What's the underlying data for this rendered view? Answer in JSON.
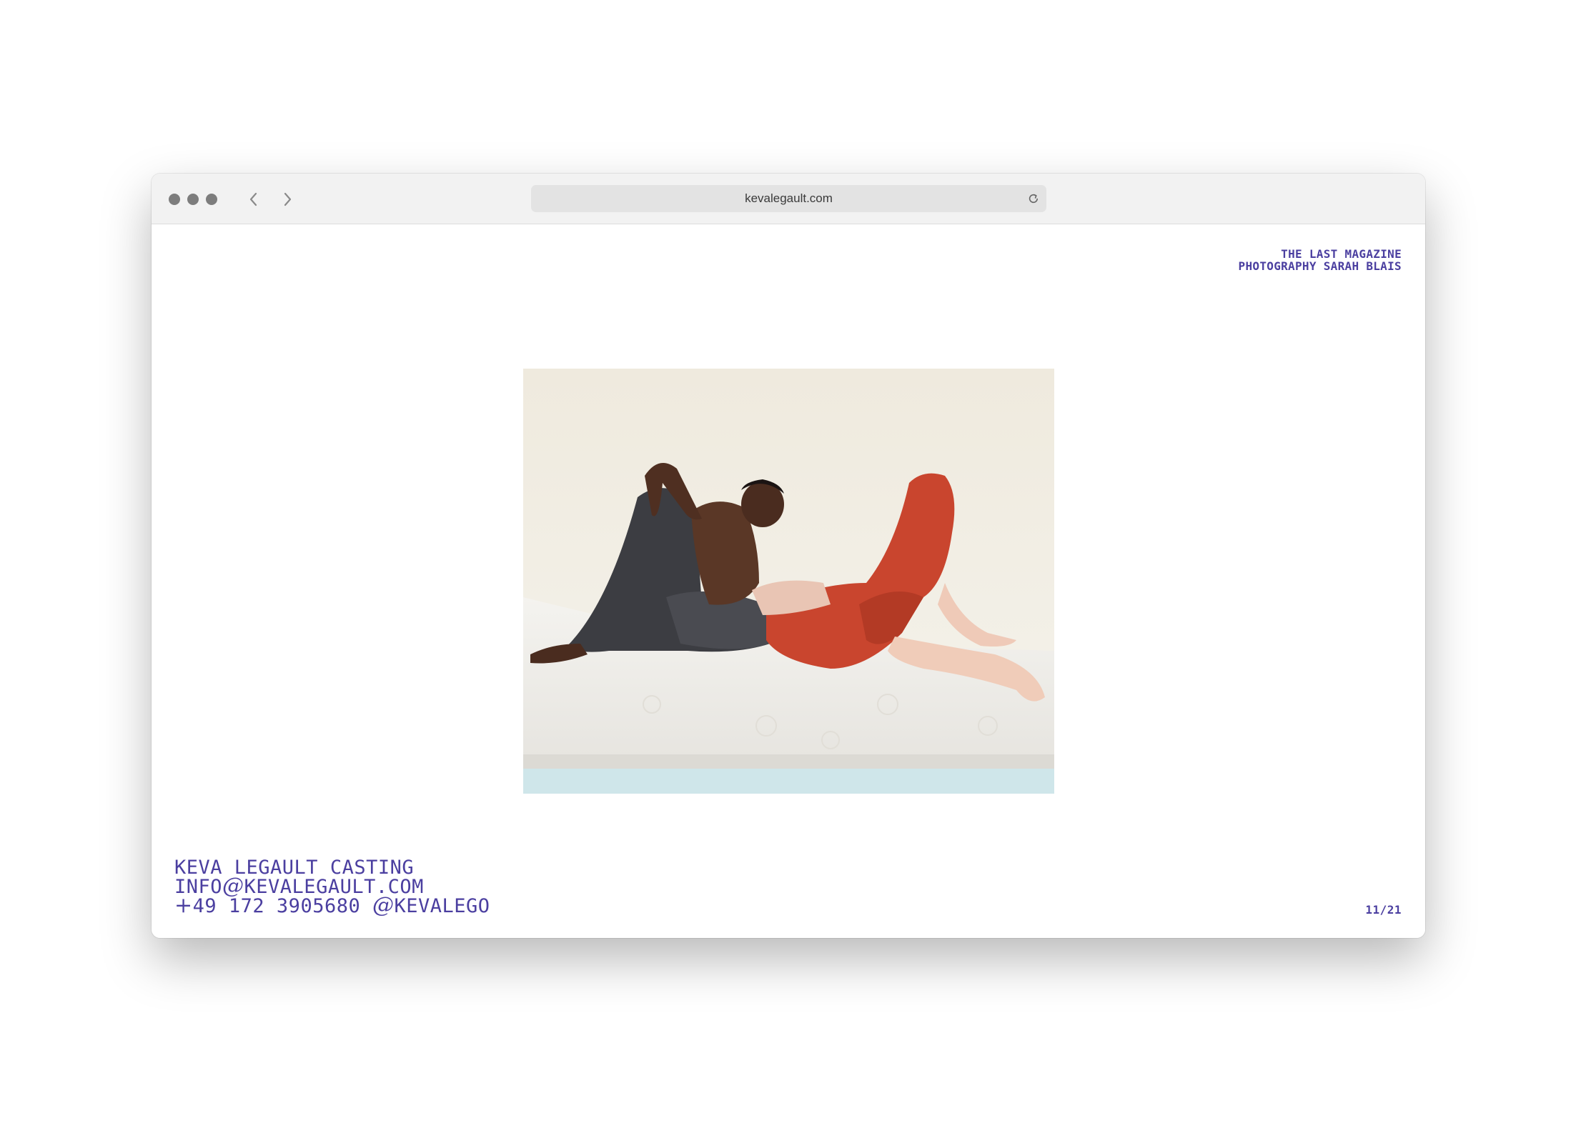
{
  "browser": {
    "url": "kevalegault.com"
  },
  "credit": {
    "line1": "THE LAST MAGAZINE",
    "line2": "PHOTOGRAPHY SARAH BLAIS"
  },
  "contact": {
    "name": "KEVA LEGAULT CASTING",
    "email_user": "INFO",
    "email_at": "@",
    "email_domain": "KEVALEGAULT.COM",
    "phone_plus": "+",
    "phone": "49 172 3905680",
    "handle_at": "@",
    "handle": "KEVALEGO"
  },
  "pager": {
    "counter": "11/21"
  },
  "colors": {
    "accent": "#4b3fa0",
    "titlebar": "#f2f2f2"
  }
}
